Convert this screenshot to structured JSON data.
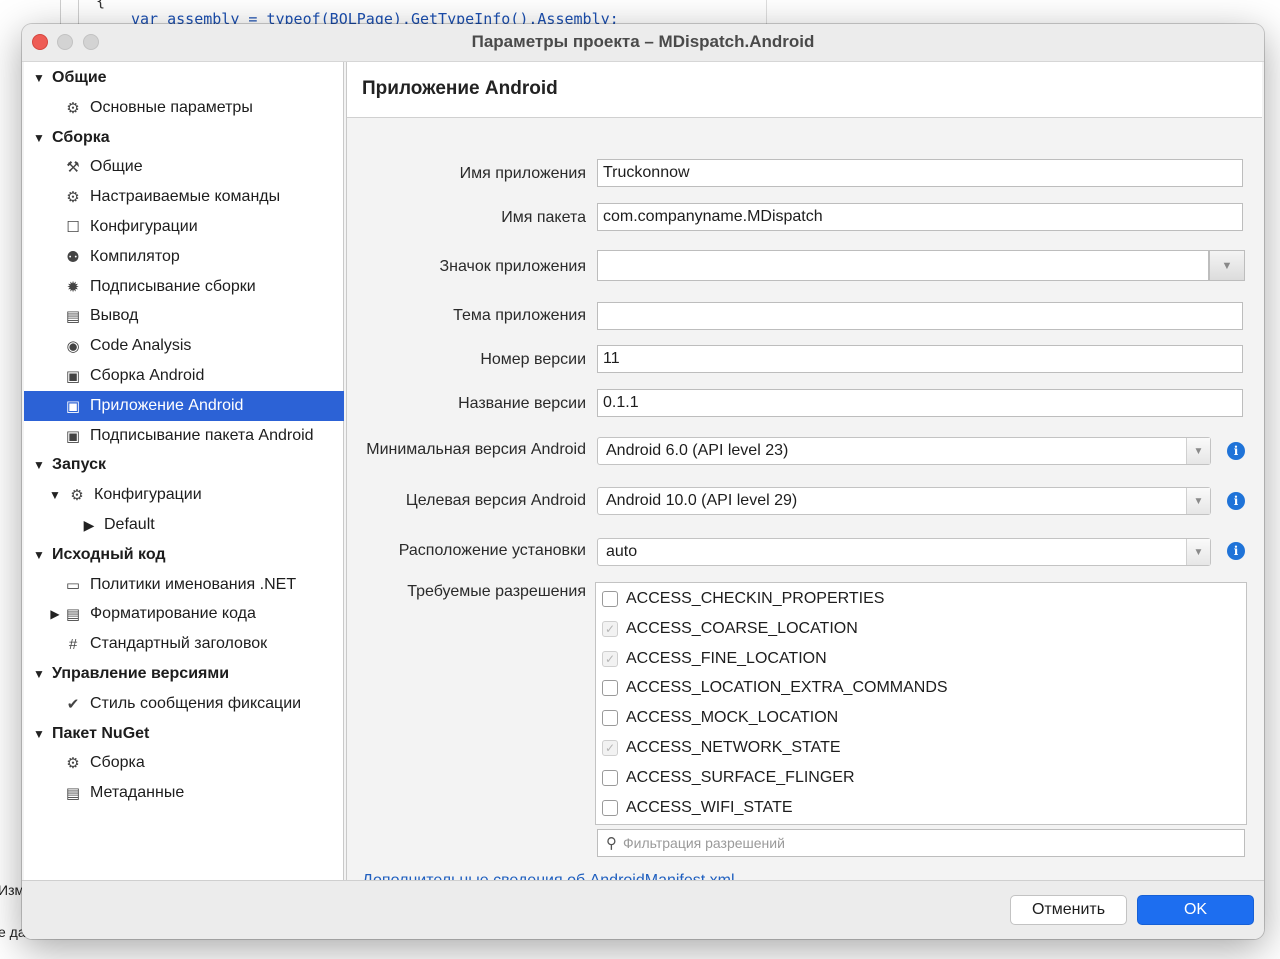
{
  "background": {
    "code_line": "var assembly = typeof(BOLPage).GetTypeInfo().Assembly;",
    "brace": "{",
    "left_text_1": "Изм",
    "left_text_2": "е да"
  },
  "window": {
    "title": "Параметры проекта – MDispatch.Android"
  },
  "sidebar": {
    "items": [
      {
        "label": "Общие",
        "type": "group",
        "icon": ""
      },
      {
        "label": "Основные параметры",
        "type": "item",
        "icon": "⚙"
      },
      {
        "label": "Сборка",
        "type": "group",
        "icon": ""
      },
      {
        "label": "Общие",
        "type": "item",
        "icon": "⚒"
      },
      {
        "label": "Настраиваемые команды",
        "type": "item",
        "icon": "⚙"
      },
      {
        "label": "Конфигурации",
        "type": "item",
        "icon": "☐"
      },
      {
        "label": "Компилятор",
        "type": "item",
        "icon": "⚉"
      },
      {
        "label": "Подписывание сборки",
        "type": "item",
        "icon": "✹"
      },
      {
        "label": "Вывод",
        "type": "item",
        "icon": "▤"
      },
      {
        "label": "Code Analysis",
        "type": "item",
        "icon": "◉"
      },
      {
        "label": "Сборка Android",
        "type": "item",
        "icon": "▣"
      },
      {
        "label": "Приложение Android",
        "type": "item",
        "icon": "▣",
        "selected": true
      },
      {
        "label": "Подписывание пакета Android",
        "type": "item",
        "icon": "▣"
      },
      {
        "label": "Запуск",
        "type": "group",
        "icon": ""
      },
      {
        "label": "Конфигурации",
        "type": "subgroup",
        "icon": "⚙"
      },
      {
        "label": "Default",
        "type": "leaf",
        "icon": ""
      },
      {
        "label": "Исходный код",
        "type": "group",
        "icon": ""
      },
      {
        "label": "Политики именования .NET",
        "type": "item",
        "icon": "▭"
      },
      {
        "label": "Форматирование кода",
        "type": "collapsed",
        "icon": "▤"
      },
      {
        "label": "Стандартный заголовок",
        "type": "item",
        "icon": "#"
      },
      {
        "label": "Управление версиями",
        "type": "group",
        "icon": ""
      },
      {
        "label": "Стиль сообщения фиксации",
        "type": "item",
        "icon": "✔"
      },
      {
        "label": "Пакет NuGet",
        "type": "group",
        "icon": ""
      },
      {
        "label": "Сборка",
        "type": "item",
        "icon": "⚙"
      },
      {
        "label": "Метаданные",
        "type": "item",
        "icon": "▤"
      }
    ]
  },
  "main": {
    "title": "Приложение Android",
    "fields": {
      "app_name": {
        "label": "Имя приложения",
        "value": "Truckonnow"
      },
      "package_name": {
        "label": "Имя пакета",
        "value": "com.companyname.MDispatch"
      },
      "app_icon": {
        "label": "Значок приложения",
        "value": ""
      },
      "app_theme": {
        "label": "Тема приложения",
        "value": ""
      },
      "version_number": {
        "label": "Номер версии",
        "value": "11"
      },
      "version_name": {
        "label": "Название версии",
        "value": "0.1.1"
      },
      "min_android": {
        "label": "Минимальная версия Android",
        "value": "Android 6.0 (API level 23)"
      },
      "target_android": {
        "label": "Целевая версия Android",
        "value": "Android 10.0 (API level 29)"
      },
      "install_location": {
        "label": "Расположение установки",
        "value": "auto"
      }
    },
    "permissions_label": "Требуемые разрешения",
    "permissions": [
      {
        "name": "ACCESS_CHECKIN_PROPERTIES",
        "checked": false
      },
      {
        "name": "ACCESS_COARSE_LOCATION",
        "checked": true
      },
      {
        "name": "ACCESS_FINE_LOCATION",
        "checked": true
      },
      {
        "name": "ACCESS_LOCATION_EXTRA_COMMANDS",
        "checked": false
      },
      {
        "name": "ACCESS_MOCK_LOCATION",
        "checked": false
      },
      {
        "name": "ACCESS_NETWORK_STATE",
        "checked": true
      },
      {
        "name": "ACCESS_SURFACE_FLINGER",
        "checked": false
      },
      {
        "name": "ACCESS_WIFI_STATE",
        "checked": false
      }
    ],
    "filter_placeholder": "Фильтрация разрешений",
    "manifest_link": "Дополнительные сведения об AndroidManifest.xml"
  },
  "footer": {
    "cancel_label": "Отменить",
    "ok_label": "OK"
  },
  "colors": {
    "selection": "#2c62d6",
    "ok_button": "#1d6ef0",
    "info_icon": "#1f73d8",
    "link": "#1f5fbf"
  }
}
